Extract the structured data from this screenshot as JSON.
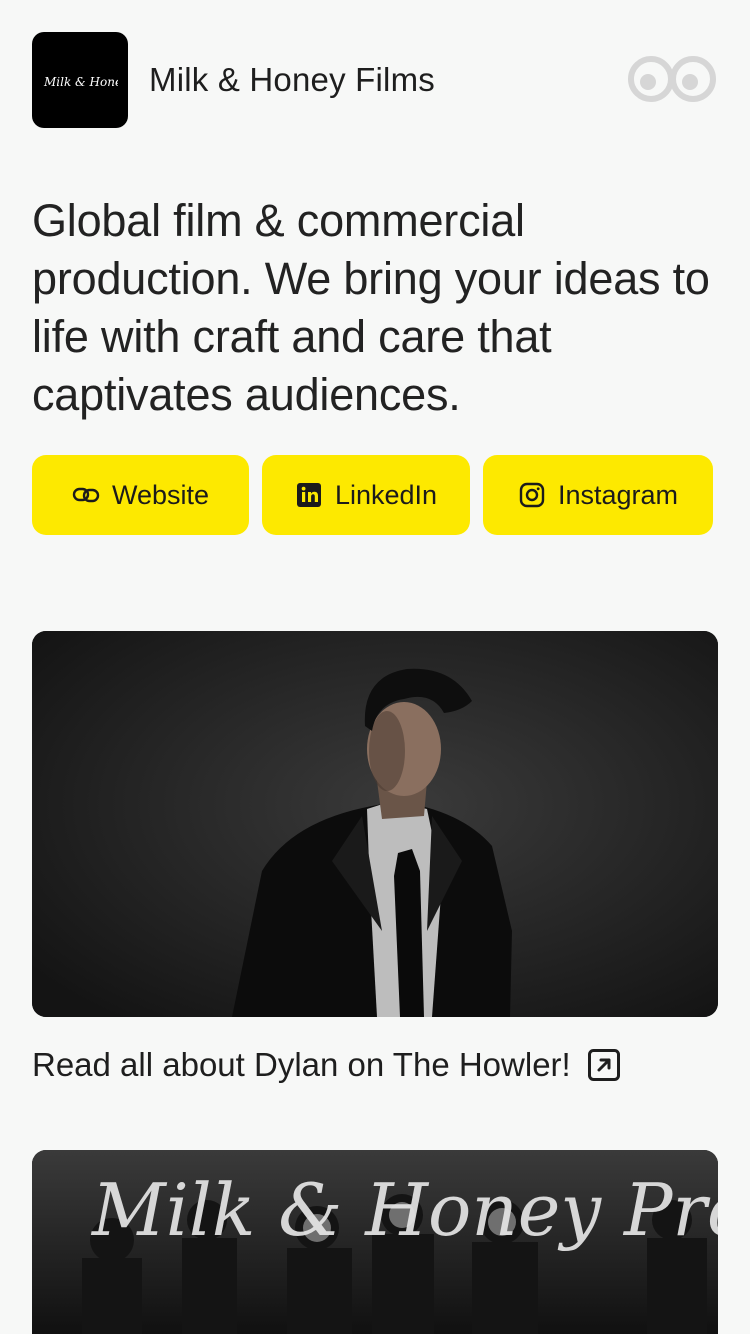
{
  "profile": {
    "logo_text": "Milk & Honey",
    "name": "Milk & Honey Films",
    "bio": "Global film & commercial production. We bring your ideas to life with craft and care that captivates audiences."
  },
  "links": [
    {
      "label": "Website",
      "icon": "link-icon"
    },
    {
      "label": "LinkedIn",
      "icon": "linkedin-icon"
    },
    {
      "label": "Instagram",
      "icon": "instagram-icon"
    }
  ],
  "cards": [
    {
      "caption": "Read all about Dylan on The Howler!",
      "icon": "external-link-icon",
      "image": "portrait-photo"
    },
    {
      "overlay_text": "Milk & Honey Productions",
      "image": "crew-photo"
    }
  ],
  "colors": {
    "accent": "#fde900",
    "background": "#f7f8f7",
    "text": "#1e1e1e"
  }
}
